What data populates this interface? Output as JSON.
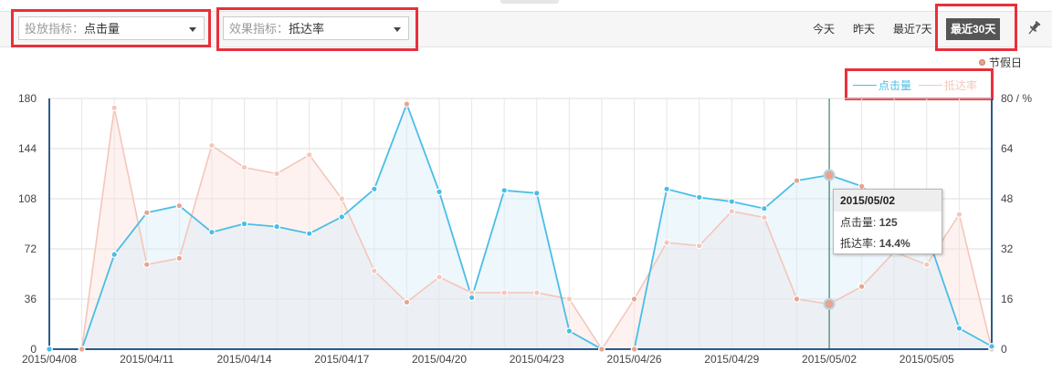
{
  "toolbar": {
    "metric1": {
      "label": "投放指标：",
      "value": "点击量"
    },
    "metric2": {
      "label": "效果指标：",
      "value": "抵达率"
    },
    "ranges": [
      "今天",
      "昨天",
      "最近7天",
      "最近30天"
    ],
    "active_range": "最近30天",
    "pin_icon": "pin-icon"
  },
  "holiday_legend": "节假日",
  "colors": {
    "clicks": "#4bbde6",
    "reach": "#f5c6ba",
    "holiday": "#e6a58e",
    "cursor": "#1a6b4a",
    "axis": "#2b5a8c"
  },
  "chart_data": {
    "type": "line",
    "dates": [
      "2015/04/08",
      "2015/04/09",
      "2015/04/10",
      "2015/04/11",
      "2015/04/12",
      "2015/04/13",
      "2015/04/14",
      "2015/04/15",
      "2015/04/16",
      "2015/04/17",
      "2015/04/18",
      "2015/04/19",
      "2015/04/20",
      "2015/04/21",
      "2015/04/22",
      "2015/04/23",
      "2015/04/24",
      "2015/04/25",
      "2015/04/26",
      "2015/04/27",
      "2015/04/28",
      "2015/04/29",
      "2015/04/30",
      "2015/05/01",
      "2015/05/02",
      "2015/05/03",
      "2015/05/04",
      "2015/05/05",
      "2015/05/06",
      "2015/05/07"
    ],
    "x_tick_labels": [
      "2015/04/08",
      "2015/04/11",
      "2015/04/14",
      "2015/04/17",
      "2015/04/20",
      "2015/04/23",
      "2015/04/26",
      "2015/04/29",
      "2015/05/02",
      "2015/05/05"
    ],
    "series": [
      {
        "name": "点击量",
        "axis": "left",
        "values": [
          0,
          0,
          68,
          98,
          103,
          84,
          90,
          88,
          83,
          95,
          115,
          176,
          113,
          37,
          114,
          112,
          13,
          0,
          0,
          115,
          109,
          106,
          101,
          121,
          125,
          117,
          98,
          83,
          15,
          2
        ]
      },
      {
        "name": "抵达率",
        "axis": "right",
        "values": [
          0,
          0,
          77,
          27,
          29,
          65,
          58,
          56,
          62,
          48,
          25,
          15,
          23,
          18,
          18,
          18,
          16,
          0,
          16,
          34,
          33,
          44,
          42,
          16,
          14.4,
          20,
          31,
          27,
          43,
          0
        ]
      }
    ],
    "holidays": [
      "2015/04/09",
      "2015/04/11",
      "2015/04/12",
      "2015/04/19",
      "2015/04/25",
      "2015/04/26",
      "2015/05/01",
      "2015/05/02",
      "2015/05/03"
    ],
    "y_left": {
      "ticks": [
        0,
        36,
        72,
        108,
        144,
        180
      ],
      "min": 0,
      "max": 180
    },
    "y_right": {
      "ticks": [
        0,
        16,
        32,
        48,
        64,
        "80 / %"
      ],
      "min": 0,
      "max": 80
    },
    "legend_position": "top-right",
    "grid": true,
    "highlighted_date": "2015/05/02"
  },
  "tooltip": {
    "date": "2015/05/02",
    "rows": [
      {
        "label": "点击量:",
        "value": "125"
      },
      {
        "label": "抵达率:",
        "value": "14.4%"
      }
    ]
  }
}
